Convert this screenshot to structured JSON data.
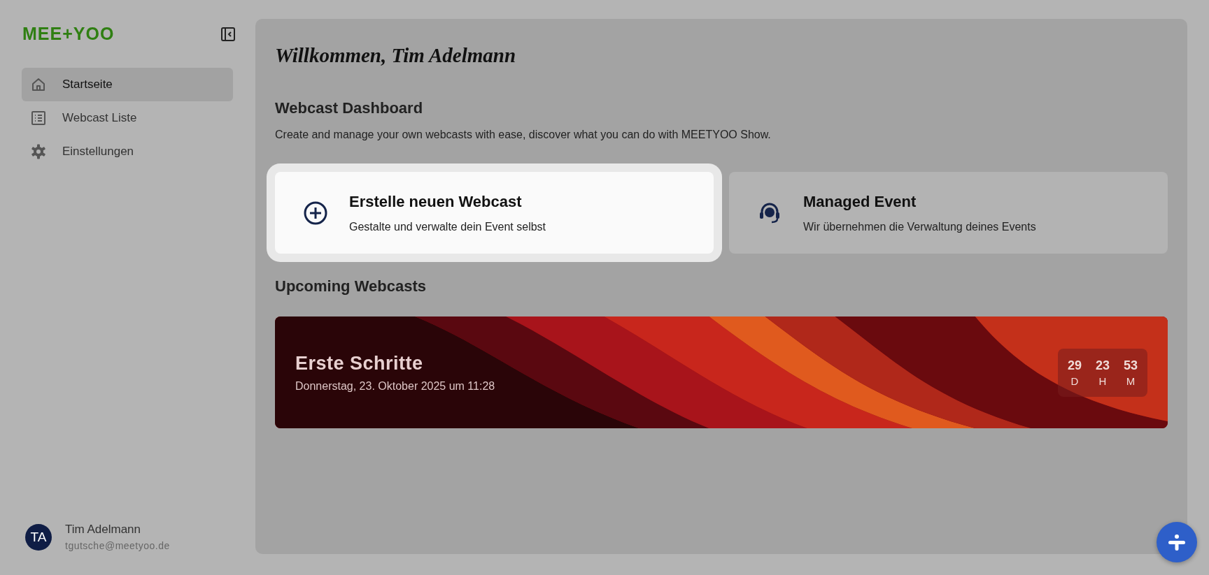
{
  "sidebar": {
    "logo": "MEE+YOO",
    "items": [
      {
        "label": "Startseite",
        "kind": "home",
        "selected": true
      },
      {
        "label": "Webcast Liste",
        "kind": "list",
        "selected": false
      },
      {
        "label": "Einstellungen",
        "kind": "gear",
        "selected": false
      }
    ],
    "user": {
      "initials": "TA",
      "name": "Tim Adelmann",
      "email": "tgutsche@meetyoo.de"
    }
  },
  "main": {
    "greeting": "Willkommen, Tim Adelmann",
    "heading": "Webcast Dashboard",
    "description": "Create and manage your own webcasts with ease, discover what you can do with MEETYOO Show.",
    "cards": [
      {
        "kind": "plus",
        "title": "Erstelle neuen Webcast",
        "subtitle": "Gestalte und verwalte dein Event selbst",
        "highlighted": true
      },
      {
        "kind": "headset",
        "title": "Managed Event",
        "subtitle": "Wir übernehmen die Verwaltung deines Events",
        "highlighted": false
      }
    ],
    "upcoming_heading": "Upcoming Webcasts",
    "webcasts": [
      {
        "title": "Erste Schritte",
        "date": "Donnerstag, 23. Oktober 2025 um 11:28",
        "countdown": [
          {
            "value": "29",
            "unit": "D"
          },
          {
            "value": "23",
            "unit": "H"
          },
          {
            "value": "53",
            "unit": "M"
          }
        ]
      }
    ]
  }
}
